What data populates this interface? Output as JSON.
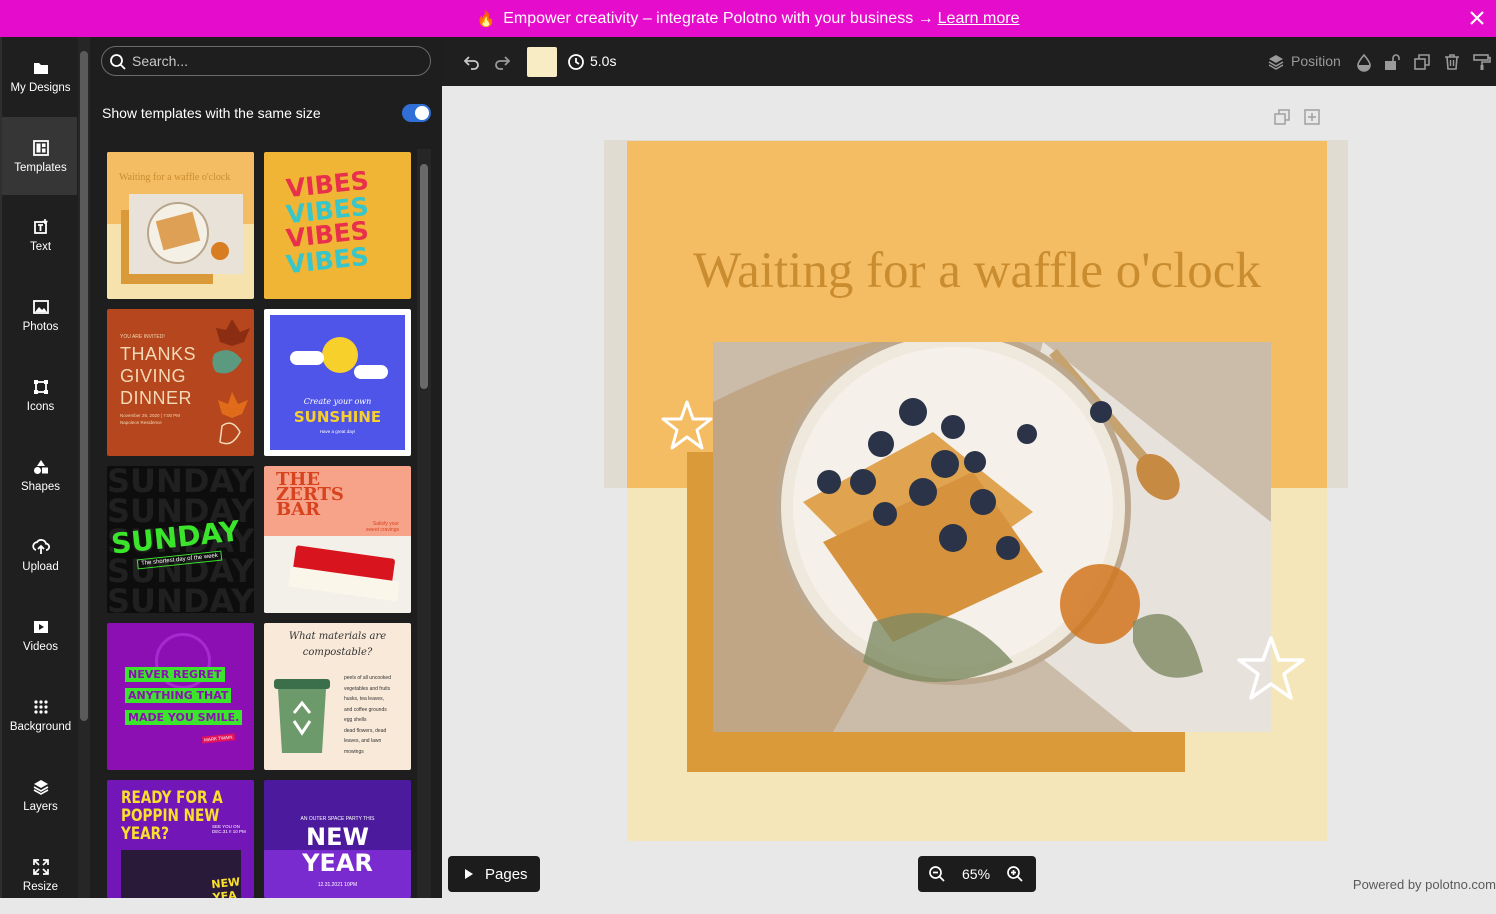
{
  "banner": {
    "icon": "fire-icon",
    "text": "Empower creativity – integrate Polotno with your business →",
    "link": "Learn more",
    "background": "#e60ccb"
  },
  "sidebar": {
    "items": [
      {
        "label": "My Designs",
        "icon": "folder-icon"
      },
      {
        "label": "Templates",
        "icon": "templates-icon",
        "active": true
      },
      {
        "label": "Text",
        "icon": "text-icon"
      },
      {
        "label": "Photos",
        "icon": "photo-icon"
      },
      {
        "label": "Icons",
        "icon": "vector-icon"
      },
      {
        "label": "Shapes",
        "icon": "shapes-icon"
      },
      {
        "label": "Upload",
        "icon": "upload-icon"
      },
      {
        "label": "Videos",
        "icon": "video-icon"
      },
      {
        "label": "Background",
        "icon": "background-icon"
      },
      {
        "label": "Layers",
        "icon": "layers-icon"
      },
      {
        "label": "Resize",
        "icon": "resize-icon"
      }
    ]
  },
  "panel": {
    "search_placeholder": "Search...",
    "toggle_label": "Show templates with the same size",
    "toggle_on": true,
    "templates": {
      "t1": {
        "line1": "Waiting for a waffle o'clock"
      },
      "t2": {
        "line1": "VIBES",
        "line2": "VIBES",
        "line3": "VIBES",
        "line4": "VIBES"
      },
      "t3": {
        "invite": "YOU ARE INVITED!",
        "line1": "THANKS",
        "line2": "GIVING",
        "line3": "DINNER",
        "date": "November 26, 2020 | 7:00 PM",
        "place": "Napoleon Residence"
      },
      "t4": {
        "script": "Create your own",
        "word": "SUNSHINE",
        "tag": "Have a great day!"
      },
      "t5": {
        "word": "SUNDAY",
        "tag": "The shortest day of the week"
      },
      "t6": {
        "line1": "THE",
        "line2": "ZERTS",
        "line3": "BAR",
        "tag1": "Satisfy your",
        "tag2": "sweet cravings"
      },
      "t7": {
        "line1": "NEVER REGRET",
        "line2": "ANYTHING THAT",
        "line3": "MADE YOU SMILE.",
        "author": "MARK TWAIN"
      },
      "t8": {
        "title1": "What materials are",
        "title2": "compostable?",
        "items": [
          "peels of all uncooked",
          "vegetables and fruits",
          "husks, tea leaves,",
          "and coffee grounds",
          "egg shells",
          "dead flowers, dead",
          "leaves, and lawn",
          "mowings"
        ]
      },
      "t9": {
        "line1": "READY FOR A",
        "line2": "POPPIN NEW",
        "line3": "YEAR?",
        "side": "SEE YOU ON DEC.31 !! 10 PM",
        "ny": "NEW YEA"
      },
      "t10": {
        "pre": "AN OUTER SPACE PARTY THIS",
        "line1": "NEW",
        "line2": "YEAR",
        "date": "12.31.2021 10PM"
      }
    }
  },
  "toolbar": {
    "duration": "5.0s",
    "fill_color": "#f7ecc4",
    "position_label": "Position"
  },
  "canvas": {
    "title": "Waiting for a waffle o'clock",
    "bg_top": "#f4bc63",
    "bg_bottom": "#f5e6b9",
    "frame_color": "#da9a3a"
  },
  "footer": {
    "pages_label": "Pages",
    "zoom": "65%",
    "powered": "Powered by polotno.com"
  }
}
